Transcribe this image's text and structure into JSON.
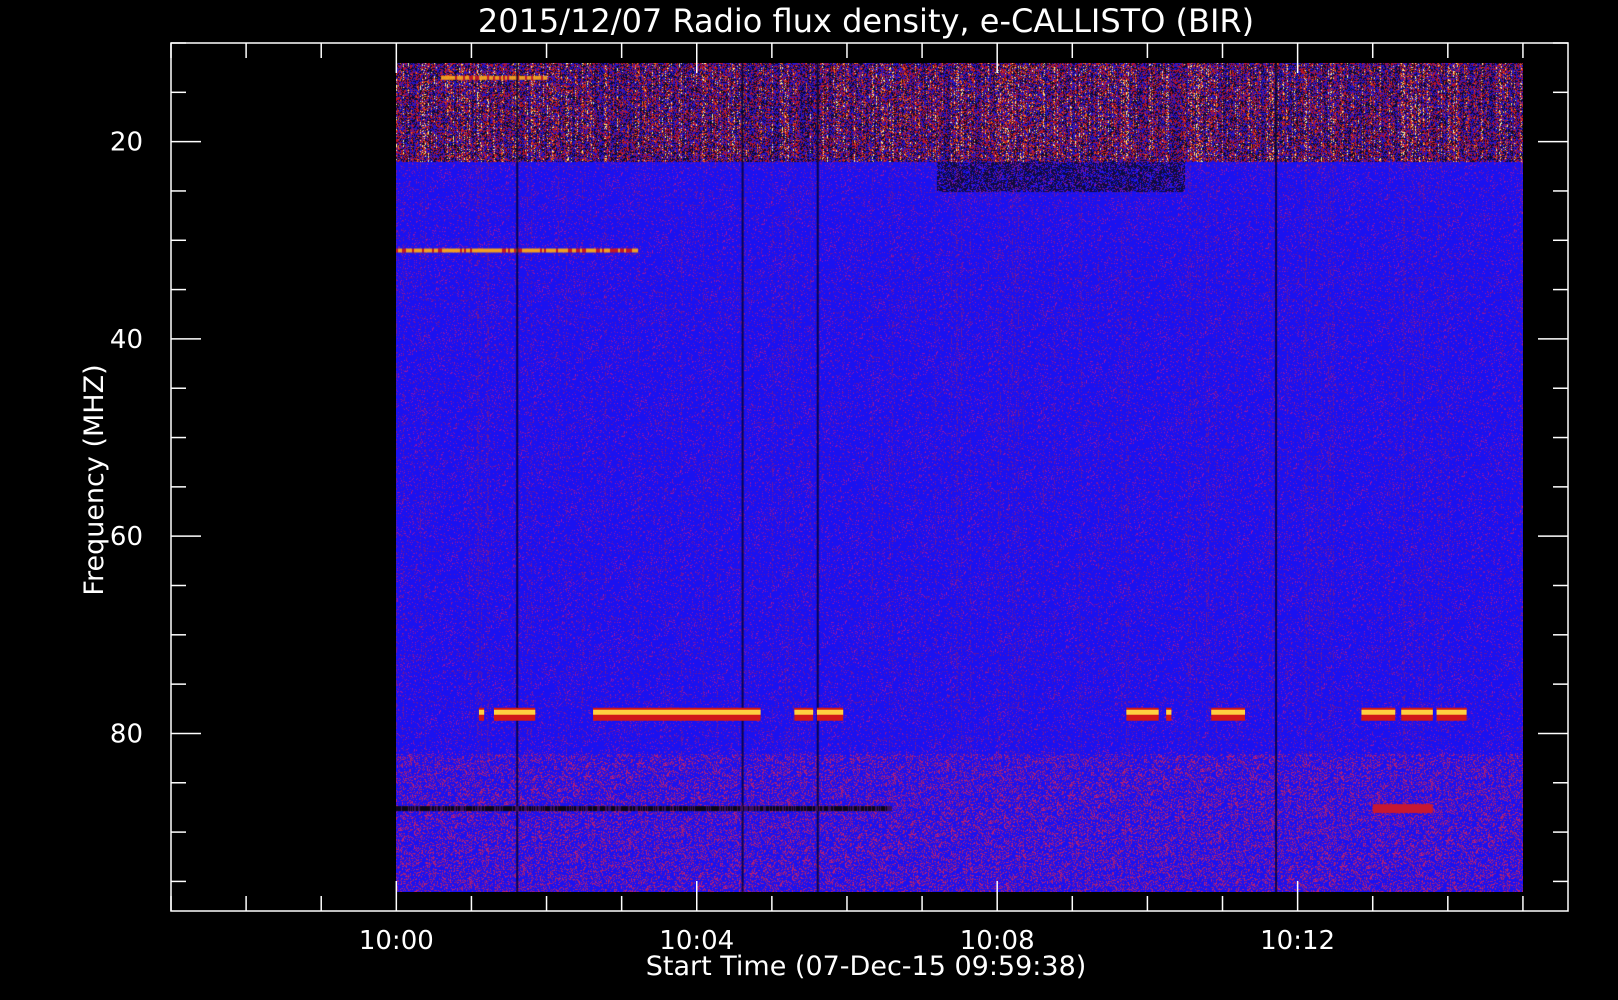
{
  "chart_data": {
    "type": "heatmap",
    "title": "2015/12/07  Radio flux density, e-CALLISTO (BIR)",
    "xlabel": "Start Time (07-Dec-15 09:59:38)",
    "ylabel": "Frequency (MHZ)",
    "x_axis": {
      "unit": "clock time (minutes after 10:00)",
      "range_minutes": [
        -3.0,
        15.6
      ],
      "data_extent_minutes": [
        0.0,
        15.0
      ],
      "major_ticks": [
        {
          "minute": 0,
          "label": "10:00"
        },
        {
          "minute": 4,
          "label": "10:04"
        },
        {
          "minute": 8,
          "label": "10:08"
        },
        {
          "minute": 12,
          "label": "10:12"
        }
      ],
      "minor_tick_interval_minutes": 1
    },
    "y_axis": {
      "unit": "MHz",
      "range": [
        10,
        98
      ],
      "data_extent": [
        12,
        96
      ],
      "inverted": true,
      "major_ticks": [
        20,
        40,
        60,
        80
      ],
      "minor_tick_interval": 5
    },
    "colormap": {
      "low": "#1a10f0",
      "mid": "#c8102a",
      "high": "#ffffc0"
    },
    "features": [
      {
        "kind": "noise-band",
        "freq_range": [
          12,
          22
        ],
        "description_level": "high"
      },
      {
        "kind": "absorption-band",
        "freq_range": [
          22,
          25
        ],
        "time_range": [
          7.2,
          10.5
        ]
      },
      {
        "kind": "narrow-line",
        "freq": 31,
        "time_range": [
          0.0,
          3.2
        ]
      },
      {
        "kind": "narrow-line",
        "freq": 13.5,
        "time_range": [
          0.6,
          2.0
        ]
      },
      {
        "kind": "vertical-artifact",
        "minute": 1.6
      },
      {
        "kind": "vertical-artifact",
        "minute": 4.6
      },
      {
        "kind": "vertical-artifact",
        "minute": 5.6
      },
      {
        "kind": "vertical-artifact",
        "minute": 11.7
      },
      {
        "kind": "dark-line",
        "freq": 87.5,
        "time_range": [
          0.0,
          6.6
        ]
      },
      {
        "kind": "emission-patch",
        "freq": 87.5,
        "time_range": [
          13.0,
          13.8
        ]
      }
    ],
    "bursts_78MHz": [
      {
        "start": 1.1,
        "end": 1.17
      },
      {
        "start": 1.3,
        "end": 1.85
      },
      {
        "start": 2.62,
        "end": 4.85
      },
      {
        "start": 5.3,
        "end": 5.55
      },
      {
        "start": 5.6,
        "end": 5.95
      },
      {
        "start": 9.72,
        "end": 10.15
      },
      {
        "start": 10.25,
        "end": 10.32
      },
      {
        "start": 10.85,
        "end": 11.3
      },
      {
        "start": 12.85,
        "end": 13.3
      },
      {
        "start": 13.38,
        "end": 13.8
      },
      {
        "start": 13.85,
        "end": 14.25
      }
    ]
  }
}
